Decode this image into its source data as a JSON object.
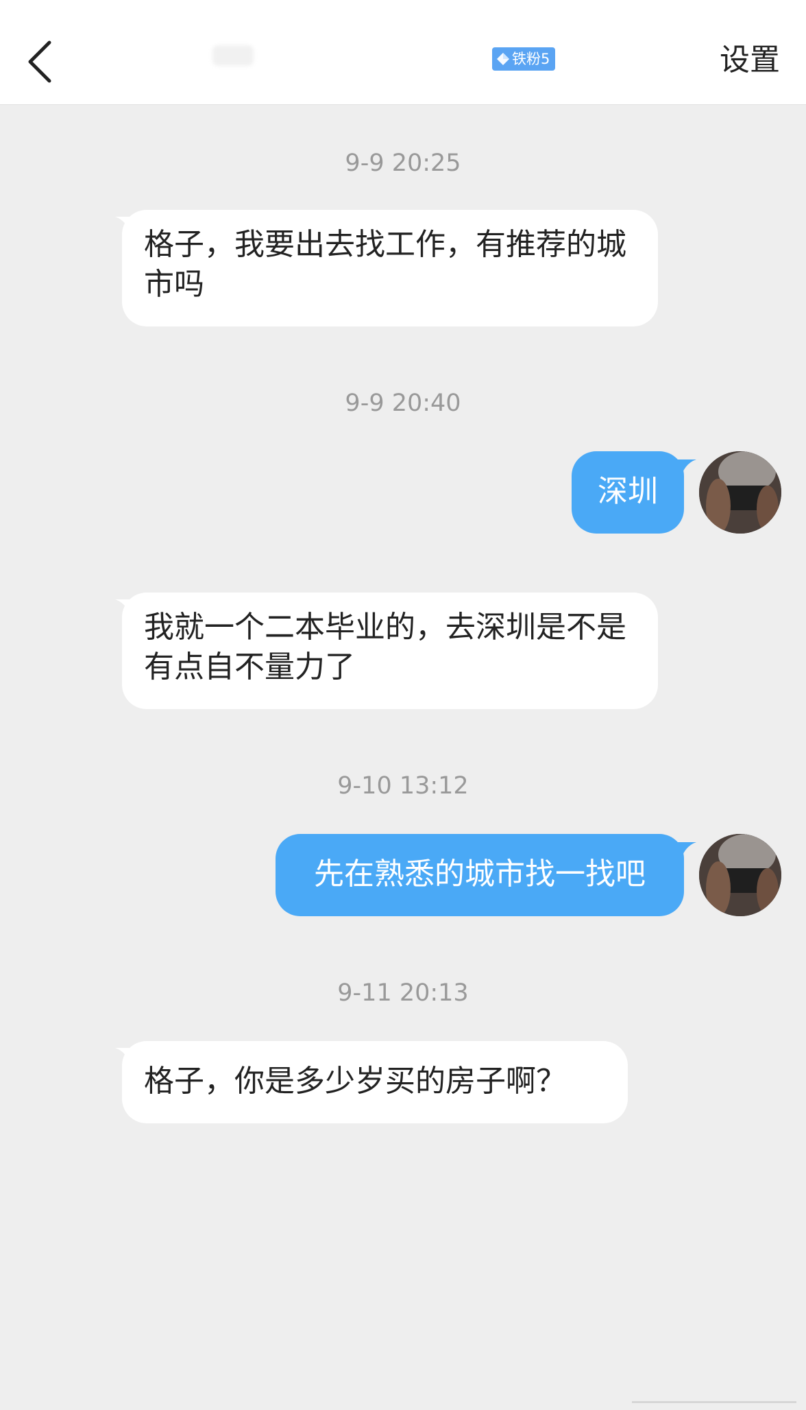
{
  "header": {
    "back_icon": "chevron-left-icon",
    "badge_label": "铁粉5",
    "badge_icon": "diamond-icon",
    "settings_label": "设置",
    "badge_color": "#5aa4f3"
  },
  "messages": [
    {
      "timestamp": "9-9 20:25",
      "direction": "incoming",
      "text": "格子，我要出去找工作，有推荐的城市吗"
    },
    {
      "timestamp": "9-9 20:40",
      "direction": "outgoing",
      "text": "深圳"
    },
    {
      "direction": "incoming",
      "text": "我就一个二本毕业的，去深圳是不是有点自不量力了"
    },
    {
      "timestamp": "9-10 13:12",
      "direction": "outgoing",
      "text": "先在熟悉的城市找一找吧"
    },
    {
      "timestamp": "9-11 20:13",
      "direction": "incoming",
      "text": "格子，你是多少岁买的房子啊？"
    }
  ],
  "colors": {
    "background": "#eeeeee",
    "incoming_bubble": "#ffffff",
    "outgoing_bubble": "#4aa9f6",
    "timestamp": "#999999"
  }
}
